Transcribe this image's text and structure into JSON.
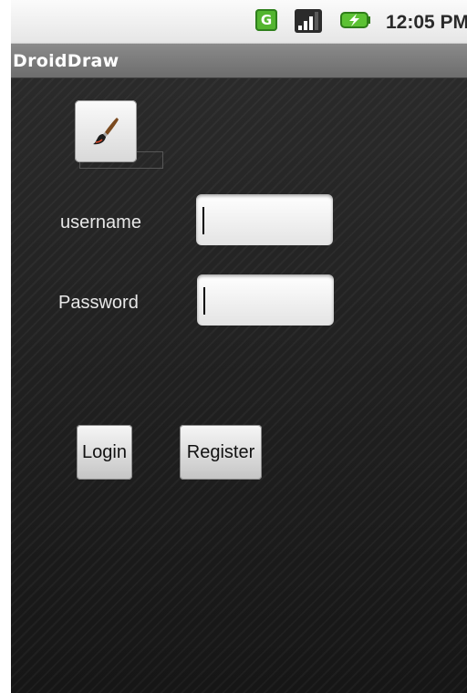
{
  "status_bar": {
    "network_badge": "G",
    "time": "12:05 PM",
    "icons": [
      "network-g-icon",
      "signal-icon",
      "battery-charging-icon"
    ]
  },
  "title_bar": {
    "title": "DroidDraw"
  },
  "form": {
    "image_button_icon": "paintbrush-icon",
    "username_label": "username",
    "password_label": "Password",
    "username_value": "",
    "password_value": ""
  },
  "buttons": {
    "login_label": "Login",
    "register_label": "Register"
  },
  "colors": {
    "status_green": "#53b530",
    "title_bar": "#7d7d7d",
    "content_background": "#222222"
  }
}
